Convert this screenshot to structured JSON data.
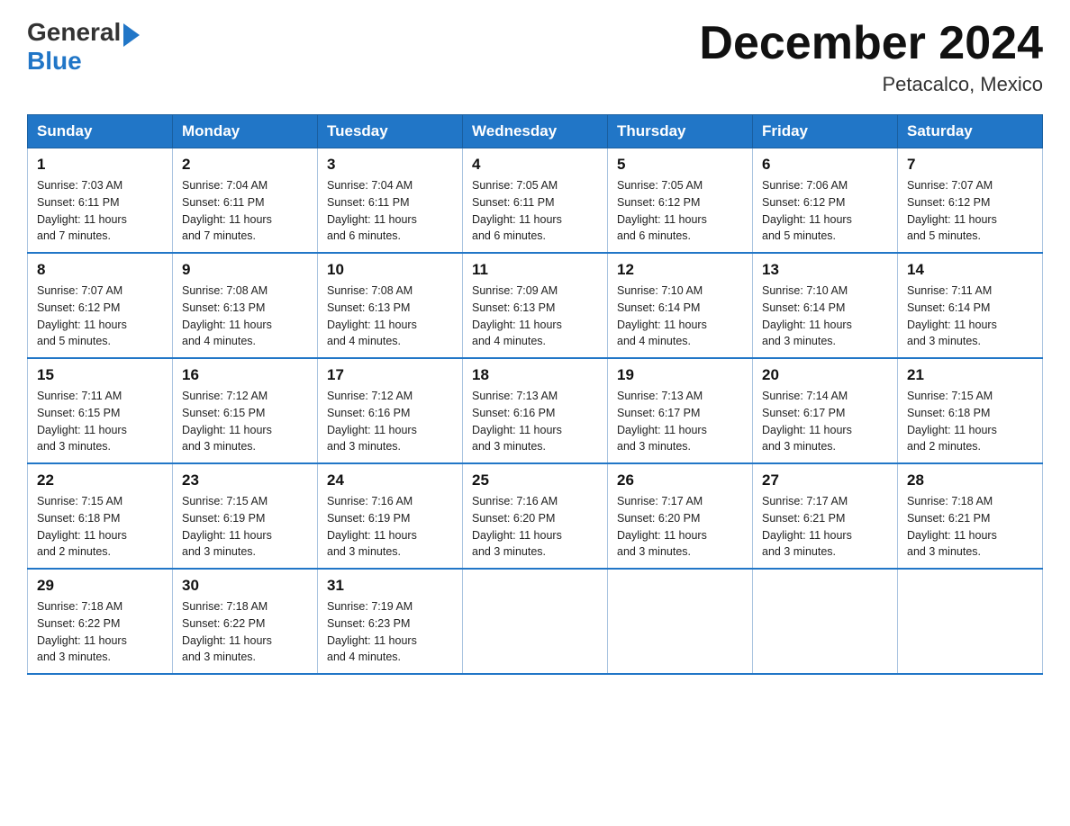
{
  "header": {
    "logo": {
      "general": "General",
      "blue": "Blue"
    },
    "title": "December 2024",
    "subtitle": "Petacalco, Mexico"
  },
  "columns": [
    "Sunday",
    "Monday",
    "Tuesday",
    "Wednesday",
    "Thursday",
    "Friday",
    "Saturday"
  ],
  "weeks": [
    [
      {
        "day": "1",
        "sunrise": "7:03 AM",
        "sunset": "6:11 PM",
        "daylight": "11 hours and 7 minutes."
      },
      {
        "day": "2",
        "sunrise": "7:04 AM",
        "sunset": "6:11 PM",
        "daylight": "11 hours and 7 minutes."
      },
      {
        "day": "3",
        "sunrise": "7:04 AM",
        "sunset": "6:11 PM",
        "daylight": "11 hours and 6 minutes."
      },
      {
        "day": "4",
        "sunrise": "7:05 AM",
        "sunset": "6:11 PM",
        "daylight": "11 hours and 6 minutes."
      },
      {
        "day": "5",
        "sunrise": "7:05 AM",
        "sunset": "6:12 PM",
        "daylight": "11 hours and 6 minutes."
      },
      {
        "day": "6",
        "sunrise": "7:06 AM",
        "sunset": "6:12 PM",
        "daylight": "11 hours and 5 minutes."
      },
      {
        "day": "7",
        "sunrise": "7:07 AM",
        "sunset": "6:12 PM",
        "daylight": "11 hours and 5 minutes."
      }
    ],
    [
      {
        "day": "8",
        "sunrise": "7:07 AM",
        "sunset": "6:12 PM",
        "daylight": "11 hours and 5 minutes."
      },
      {
        "day": "9",
        "sunrise": "7:08 AM",
        "sunset": "6:13 PM",
        "daylight": "11 hours and 4 minutes."
      },
      {
        "day": "10",
        "sunrise": "7:08 AM",
        "sunset": "6:13 PM",
        "daylight": "11 hours and 4 minutes."
      },
      {
        "day": "11",
        "sunrise": "7:09 AM",
        "sunset": "6:13 PM",
        "daylight": "11 hours and 4 minutes."
      },
      {
        "day": "12",
        "sunrise": "7:10 AM",
        "sunset": "6:14 PM",
        "daylight": "11 hours and 4 minutes."
      },
      {
        "day": "13",
        "sunrise": "7:10 AM",
        "sunset": "6:14 PM",
        "daylight": "11 hours and 3 minutes."
      },
      {
        "day": "14",
        "sunrise": "7:11 AM",
        "sunset": "6:14 PM",
        "daylight": "11 hours and 3 minutes."
      }
    ],
    [
      {
        "day": "15",
        "sunrise": "7:11 AM",
        "sunset": "6:15 PM",
        "daylight": "11 hours and 3 minutes."
      },
      {
        "day": "16",
        "sunrise": "7:12 AM",
        "sunset": "6:15 PM",
        "daylight": "11 hours and 3 minutes."
      },
      {
        "day": "17",
        "sunrise": "7:12 AM",
        "sunset": "6:16 PM",
        "daylight": "11 hours and 3 minutes."
      },
      {
        "day": "18",
        "sunrise": "7:13 AM",
        "sunset": "6:16 PM",
        "daylight": "11 hours and 3 minutes."
      },
      {
        "day": "19",
        "sunrise": "7:13 AM",
        "sunset": "6:17 PM",
        "daylight": "11 hours and 3 minutes."
      },
      {
        "day": "20",
        "sunrise": "7:14 AM",
        "sunset": "6:17 PM",
        "daylight": "11 hours and 3 minutes."
      },
      {
        "day": "21",
        "sunrise": "7:15 AM",
        "sunset": "6:18 PM",
        "daylight": "11 hours and 2 minutes."
      }
    ],
    [
      {
        "day": "22",
        "sunrise": "7:15 AM",
        "sunset": "6:18 PM",
        "daylight": "11 hours and 2 minutes."
      },
      {
        "day": "23",
        "sunrise": "7:15 AM",
        "sunset": "6:19 PM",
        "daylight": "11 hours and 3 minutes."
      },
      {
        "day": "24",
        "sunrise": "7:16 AM",
        "sunset": "6:19 PM",
        "daylight": "11 hours and 3 minutes."
      },
      {
        "day": "25",
        "sunrise": "7:16 AM",
        "sunset": "6:20 PM",
        "daylight": "11 hours and 3 minutes."
      },
      {
        "day": "26",
        "sunrise": "7:17 AM",
        "sunset": "6:20 PM",
        "daylight": "11 hours and 3 minutes."
      },
      {
        "day": "27",
        "sunrise": "7:17 AM",
        "sunset": "6:21 PM",
        "daylight": "11 hours and 3 minutes."
      },
      {
        "day": "28",
        "sunrise": "7:18 AM",
        "sunset": "6:21 PM",
        "daylight": "11 hours and 3 minutes."
      }
    ],
    [
      {
        "day": "29",
        "sunrise": "7:18 AM",
        "sunset": "6:22 PM",
        "daylight": "11 hours and 3 minutes."
      },
      {
        "day": "30",
        "sunrise": "7:18 AM",
        "sunset": "6:22 PM",
        "daylight": "11 hours and 3 minutes."
      },
      {
        "day": "31",
        "sunrise": "7:19 AM",
        "sunset": "6:23 PM",
        "daylight": "11 hours and 4 minutes."
      },
      null,
      null,
      null,
      null
    ]
  ],
  "labels": {
    "sunrise": "Sunrise:",
    "sunset": "Sunset:",
    "daylight": "Daylight:"
  }
}
